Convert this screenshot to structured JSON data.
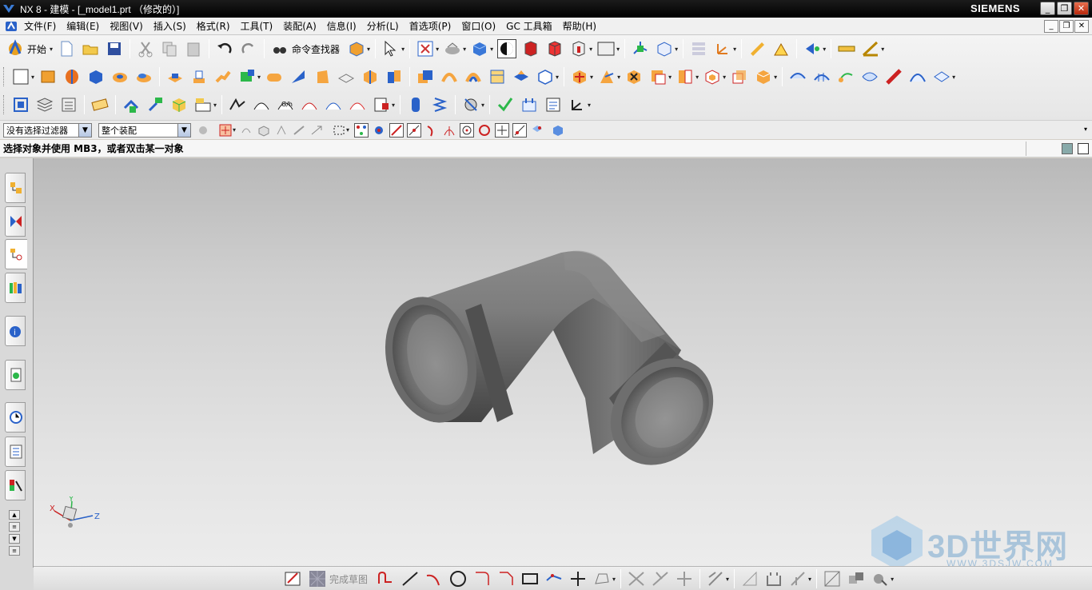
{
  "window": {
    "title": "NX 8 - 建模 - [_model1.prt （修改的）]",
    "brand": "SIEMENS",
    "controls": [
      "_",
      "❐",
      "✕"
    ]
  },
  "menu": {
    "items": [
      "文件(F)",
      "编辑(E)",
      "视图(V)",
      "插入(S)",
      "格式(R)",
      "工具(T)",
      "装配(A)",
      "信息(I)",
      "分析(L)",
      "首选项(P)",
      "窗口(O)",
      "GC 工具箱",
      "帮助(H)"
    ]
  },
  "toolbar": {
    "start_label": "开始",
    "command_finder_label": "命令查找器"
  },
  "selection": {
    "filter_value": "没有选择过滤器",
    "scope_value": "整个装配"
  },
  "cue": {
    "text": "选择对象并使用 MB3，或者双击某一对象"
  },
  "sketch_toolbar": {
    "finish_label": "完成草图"
  },
  "triad": {
    "x_label": "X",
    "y_label": "Y",
    "z_label": "Z"
  },
  "watermark": {
    "text": "3D世界网",
    "url": "WWW.3DSJW.COM"
  },
  "colors": {
    "titlebar": "#000000",
    "model_gray": "#6e6e6e",
    "accent_blue": "#2a62c9"
  }
}
